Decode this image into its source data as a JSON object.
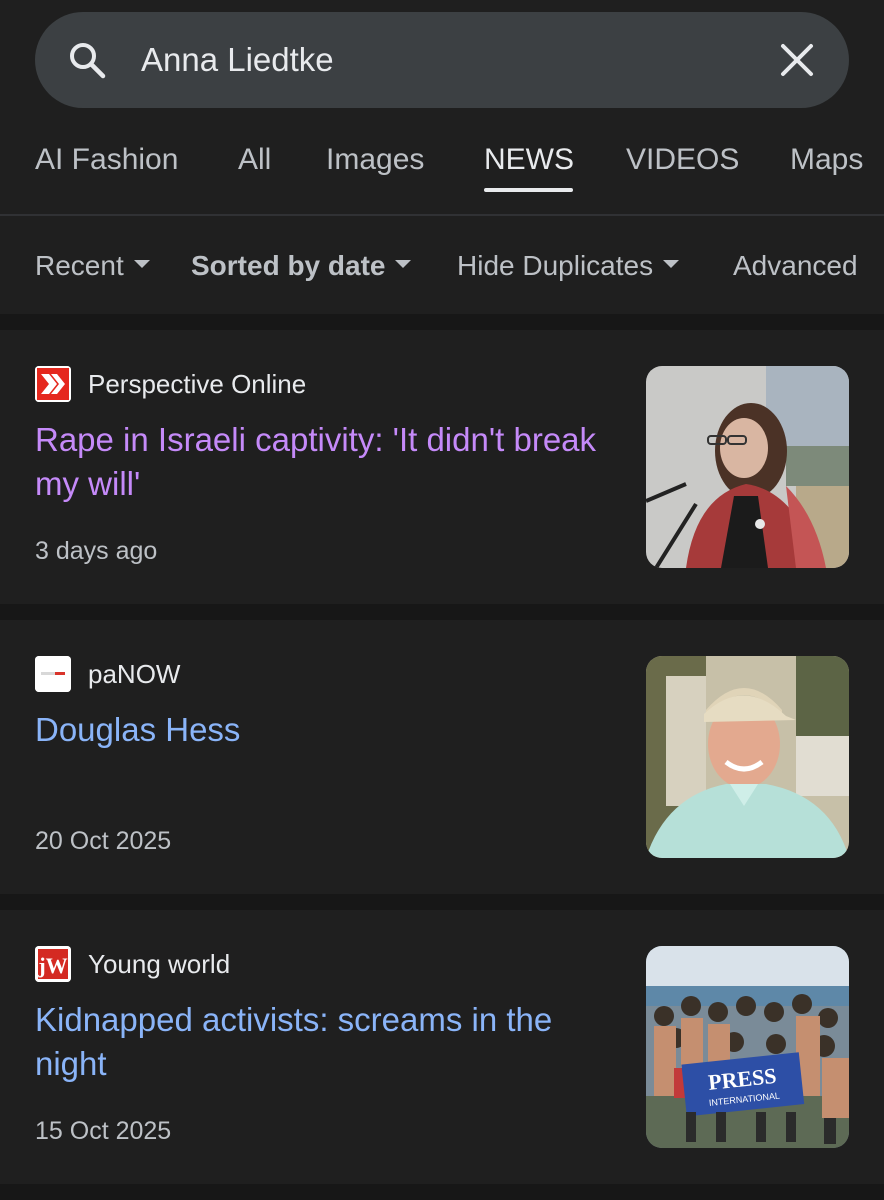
{
  "search": {
    "query": "Anna Liedtke"
  },
  "tabs": [
    {
      "label": "AI Fashion"
    },
    {
      "label": "All"
    },
    {
      "label": "Images"
    },
    {
      "label": "NEWS"
    },
    {
      "label": "VIDEOS"
    },
    {
      "label": "Maps"
    }
  ],
  "filters": [
    {
      "label": "Recent"
    },
    {
      "label": "Sorted by date"
    },
    {
      "label": "Hide Duplicates"
    },
    {
      "label": "Advanced"
    }
  ],
  "results": [
    {
      "source": "Perspective Online",
      "source_icon": "red-chevron-logo",
      "headline": "Rape in Israeli captivity: 'It didn't break my will'",
      "date": "3 days ago",
      "thumbnail": "woman-at-microphone"
    },
    {
      "source": "paNOW",
      "source_icon": "panow-logo",
      "headline": "Douglas Hess",
      "date": "20 Oct 2025",
      "thumbnail": "man-in-cap"
    },
    {
      "source": "Young world",
      "source_icon": "jw-logo",
      "headline": "Kidnapped activists: screams in the night",
      "date": "15 Oct 2025",
      "thumbnail": "group-with-press-banner"
    }
  ],
  "colors": {
    "background": "#1f1f1f",
    "visited_link": "#c58af9",
    "link": "#8ab4f8",
    "search_bar": "#3c4043"
  }
}
